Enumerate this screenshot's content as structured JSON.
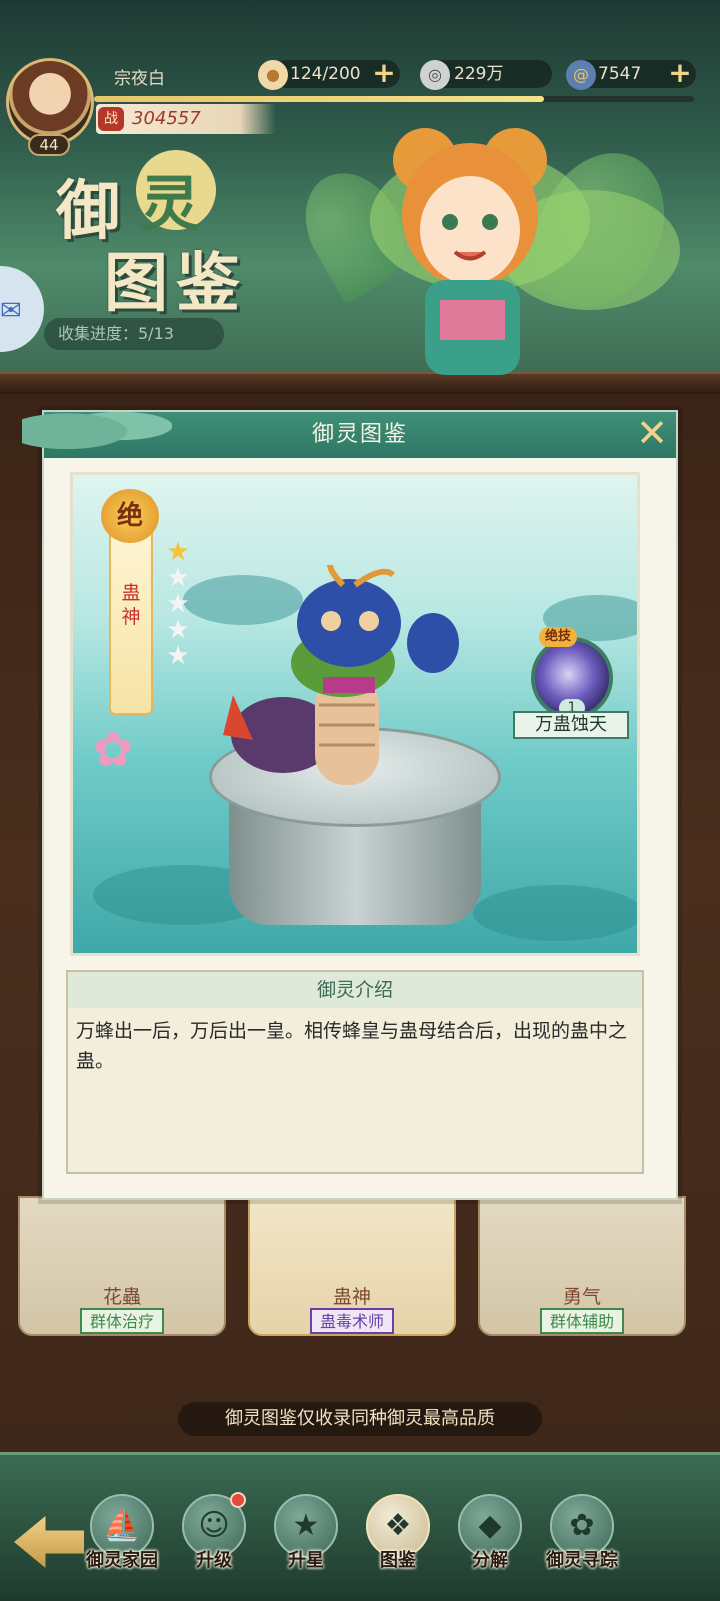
{
  "player": {
    "name": "宗夜白",
    "level": "44",
    "power_icon": "战",
    "power": "304557"
  },
  "resources": [
    {
      "icon": "steamed-bun-icon",
      "value": "124/200"
    },
    {
      "icon": "coin-icon",
      "value": "229万"
    },
    {
      "icon": "spiral-gem-icon",
      "value": "7547"
    }
  ],
  "xp_progress": 0.75,
  "title": {
    "char1": "御",
    "char2": "灵",
    "char3": "图",
    "char4": "鉴"
  },
  "collect_progress": "收集进度：5/13",
  "modal": {
    "title": "御灵图鉴",
    "grade": "绝",
    "pet_name": "蛊神",
    "stars_filled": 1,
    "stars_total": 5,
    "skill_tag": "绝技",
    "skill_level": "1",
    "skill_name": "万蛊蚀天",
    "intro_title": "御灵介绍",
    "intro_text": "万蜂出一后，万后出一皇。相传蜂皇与蛊母结合后，出现的蛊中之蛊。"
  },
  "cards": [
    {
      "name": "花蟲",
      "tag": "群体治疗",
      "tag_color": "#3f8a4a"
    },
    {
      "name": "蛊神",
      "tag": "蛊毒术师",
      "tag_color": "#6b3fa8"
    },
    {
      "name": "勇气",
      "tag": "群体辅助",
      "tag_color": "#3f8a4a"
    }
  ],
  "hint": "御灵图鉴仅收录同种御灵最高品质",
  "nav": [
    {
      "label": "御灵家园",
      "icon": "ship-icon"
    },
    {
      "label": "升级",
      "icon": "pet-face-icon",
      "badge": true
    },
    {
      "label": "升星",
      "icon": "stars-icon"
    },
    {
      "label": "图鉴",
      "icon": "cards-icon",
      "active": true
    },
    {
      "label": "分解",
      "icon": "crystal-icon"
    },
    {
      "label": "御灵寻踪",
      "icon": "footprint-icon"
    }
  ]
}
